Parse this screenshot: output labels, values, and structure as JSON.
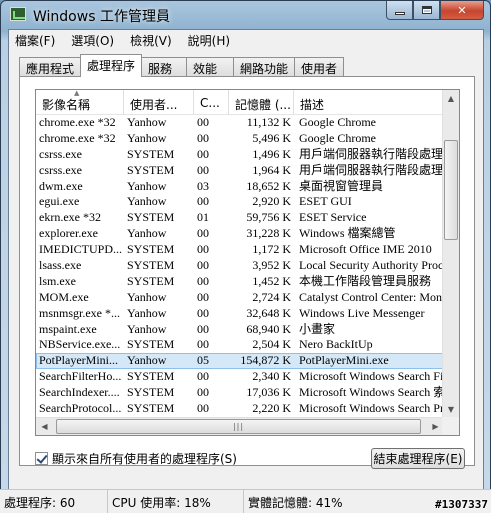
{
  "window": {
    "title": "Windows 工作管理員"
  },
  "menu": [
    "檔案(F)",
    "選項(O)",
    "檢視(V)",
    "說明(H)"
  ],
  "tabs": [
    "應用程式",
    "處理程序",
    "服務",
    "效能",
    "網路功能",
    "使用者"
  ],
  "active_tab": 1,
  "columns": [
    "影像名稱",
    "使用者...",
    "C...",
    "記憶體 (...",
    "描述"
  ],
  "rows": [
    [
      "chrome.exe *32",
      "Yanhow",
      "00",
      "11,132 K",
      "Google Chrome"
    ],
    [
      "chrome.exe *32",
      "Yanhow",
      "00",
      "5,496 K",
      "Google Chrome"
    ],
    [
      "csrss.exe",
      "SYSTEM",
      "00",
      "1,496 K",
      "用戶端伺服器執行階段處理程"
    ],
    [
      "csrss.exe",
      "SYSTEM",
      "00",
      "1,964 K",
      "用戶端伺服器執行階段處理程"
    ],
    [
      "dwm.exe",
      "Yanhow",
      "03",
      "18,652 K",
      "桌面視窗管理員"
    ],
    [
      "egui.exe",
      "Yanhow",
      "00",
      "2,920 K",
      "ESET GUI"
    ],
    [
      "ekrn.exe *32",
      "SYSTEM",
      "01",
      "59,756 K",
      "ESET Service"
    ],
    [
      "explorer.exe",
      "Yanhow",
      "00",
      "31,228 K",
      "Windows 檔案總管"
    ],
    [
      "IMEDICTUPD...",
      "SYSTEM",
      "00",
      "1,172 K",
      "Microsoft Office IME 2010"
    ],
    [
      "lsass.exe",
      "SYSTEM",
      "00",
      "3,952 K",
      "Local Security Authority Process"
    ],
    [
      "lsm.exe",
      "SYSTEM",
      "00",
      "1,452 K",
      "本機工作階段管理員服務"
    ],
    [
      "MOM.exe",
      "Yanhow",
      "00",
      "2,724 K",
      "Catalyst Control Center: Monitor"
    ],
    [
      "msnmsgr.exe *...",
      "Yanhow",
      "00",
      "32,648 K",
      "Windows Live Messenger"
    ],
    [
      "mspaint.exe",
      "Yanhow",
      "00",
      "68,940 K",
      "小畫家"
    ],
    [
      "NBService.exe...",
      "SYSTEM",
      "00",
      "2,504 K",
      "Nero BackItUp"
    ],
    [
      "PotPlayerMini...",
      "Yanhow",
      "05",
      "154,872 K",
      "PotPlayerMini.exe"
    ],
    [
      "SearchFilterHo...",
      "SYSTEM",
      "00",
      "2,340 K",
      "Microsoft Windows Search Filter"
    ],
    [
      "SearchIndexer....",
      "SYSTEM",
      "00",
      "17,036 K",
      "Microsoft Windows Search 索引"
    ],
    [
      "SearchProtocol...",
      "SYSTEM",
      "00",
      "2,220 K",
      "Microsoft Windows Search Proto"
    ]
  ],
  "selected_row": 15,
  "show_all_label": "顯示來自所有使用者的處理程序(S)",
  "end_process_label": "結束處理程序(E)",
  "status": {
    "processes": "處理程序: 60",
    "cpu": "CPU 使用率: 18%",
    "memory": "實體記憶體: 41%"
  },
  "watermark": "#1307337"
}
